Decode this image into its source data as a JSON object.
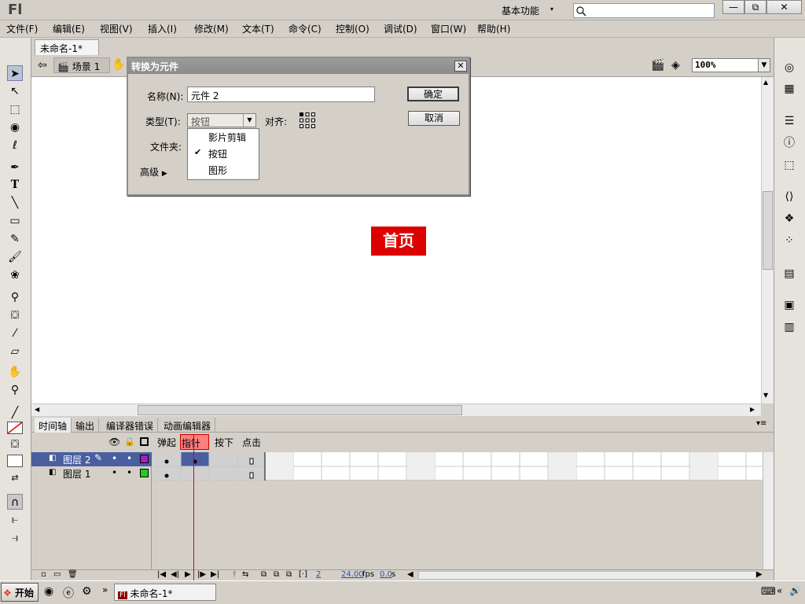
{
  "app": {
    "logo": "Fl",
    "workspace": "基本功能",
    "search_placeholder": "",
    "window_controls": [
      "—",
      "⧉",
      "✕"
    ]
  },
  "menu": [
    "文件(F)",
    "编辑(E)",
    "视图(V)",
    "插入(I)",
    "修改(M)",
    "文本(T)",
    "命令(C)",
    "控制(O)",
    "调试(D)",
    "窗口(W)",
    "帮助(H)"
  ],
  "doc_tab": {
    "label": "未命名-1*",
    "close": "×"
  },
  "editbar": {
    "scene": "场景 1",
    "zoom": "100%"
  },
  "stage": {
    "button_text": "首页",
    "button_color": "#dd0000"
  },
  "dialog": {
    "title": "转换为元件",
    "close": "✕",
    "name_label": "名称(N):",
    "name_value": "元件 2",
    "type_label": "类型(T):",
    "type_value": "按钮",
    "align_label": "对齐:",
    "folder_label": "文件夹:",
    "advanced_label": "高级",
    "ok": "确定",
    "cancel": "取消",
    "type_options": [
      "影片剪辑",
      "按钮",
      "图形"
    ],
    "selected_option": "按钮"
  },
  "timeline": {
    "tabs": [
      "时间轴",
      "输出",
      "编译器错误",
      "动画编辑器"
    ],
    "frame_labels": [
      "弹起",
      "指针 ...",
      "按下",
      "点击"
    ],
    "layers": [
      {
        "name": "图层 2",
        "color": "#a020c8",
        "selected": true
      },
      {
        "name": "图层 1",
        "color": "#22cc22",
        "selected": false
      }
    ],
    "current_frame": "2",
    "fps": "24.00",
    "fps_unit": "fps",
    "time": "0.0",
    "time_unit": "s"
  },
  "taskbar": {
    "start": "开始",
    "item": "未命名-1*",
    "chevron": "»"
  },
  "colors": {
    "accent_red": "#dd0000",
    "selection_blue": "#4a5fa0",
    "frame_highlight": "#ff7f7f"
  }
}
